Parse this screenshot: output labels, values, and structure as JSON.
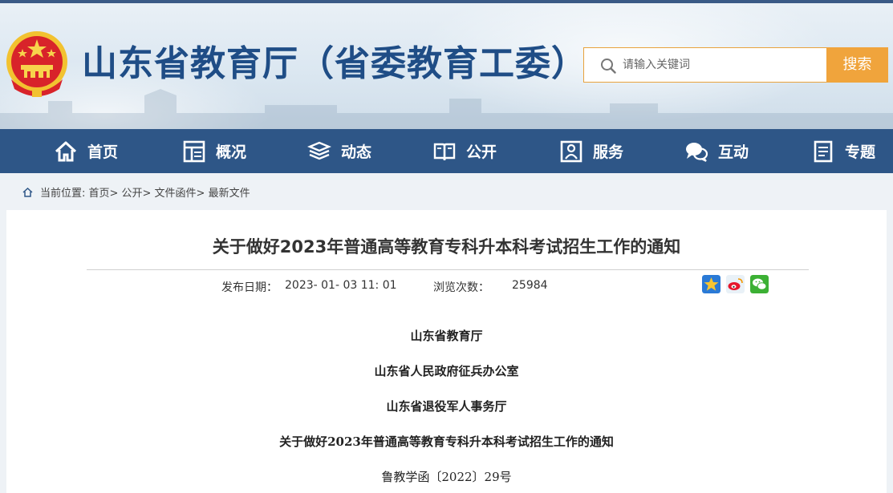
{
  "header": {
    "site_title": "山东省教育厅（省委教育工委）",
    "search_placeholder": "请输入关键词",
    "search_button": "搜索"
  },
  "nav": {
    "items": [
      {
        "label": "首页",
        "icon": "home-icon"
      },
      {
        "label": "概况",
        "icon": "overview-icon"
      },
      {
        "label": "动态",
        "icon": "news-icon"
      },
      {
        "label": "公开",
        "icon": "book-icon"
      },
      {
        "label": "服务",
        "icon": "service-icon"
      },
      {
        "label": "互动",
        "icon": "chat-icon"
      },
      {
        "label": "专题",
        "icon": "topic-icon"
      }
    ]
  },
  "breadcrumb": {
    "text": "当前位置: 首页> 公开> 文件函件> 最新文件"
  },
  "article": {
    "title": "关于做好2023年普通高等教育专科升本科考试招生工作的通知",
    "publish_label": "发布日期：",
    "publish_date": "2023- 01- 03 11: 01",
    "views_label": "浏览次数：",
    "views": "25984",
    "share": [
      "qzone-icon",
      "weibo-icon",
      "wechat-icon"
    ],
    "lines": [
      "山东省教育厅",
      "山东省人民政府征兵办公室",
      "山东省退役军人事务厅",
      "关于做好2023年普通高等教育专科升本科考试招生工作的通知",
      "鲁教学函〔2022〕29号"
    ]
  },
  "colors": {
    "nav_bg": "#2e5687",
    "title_blue": "#1f4d86",
    "search_orange": "#f0a43c"
  }
}
